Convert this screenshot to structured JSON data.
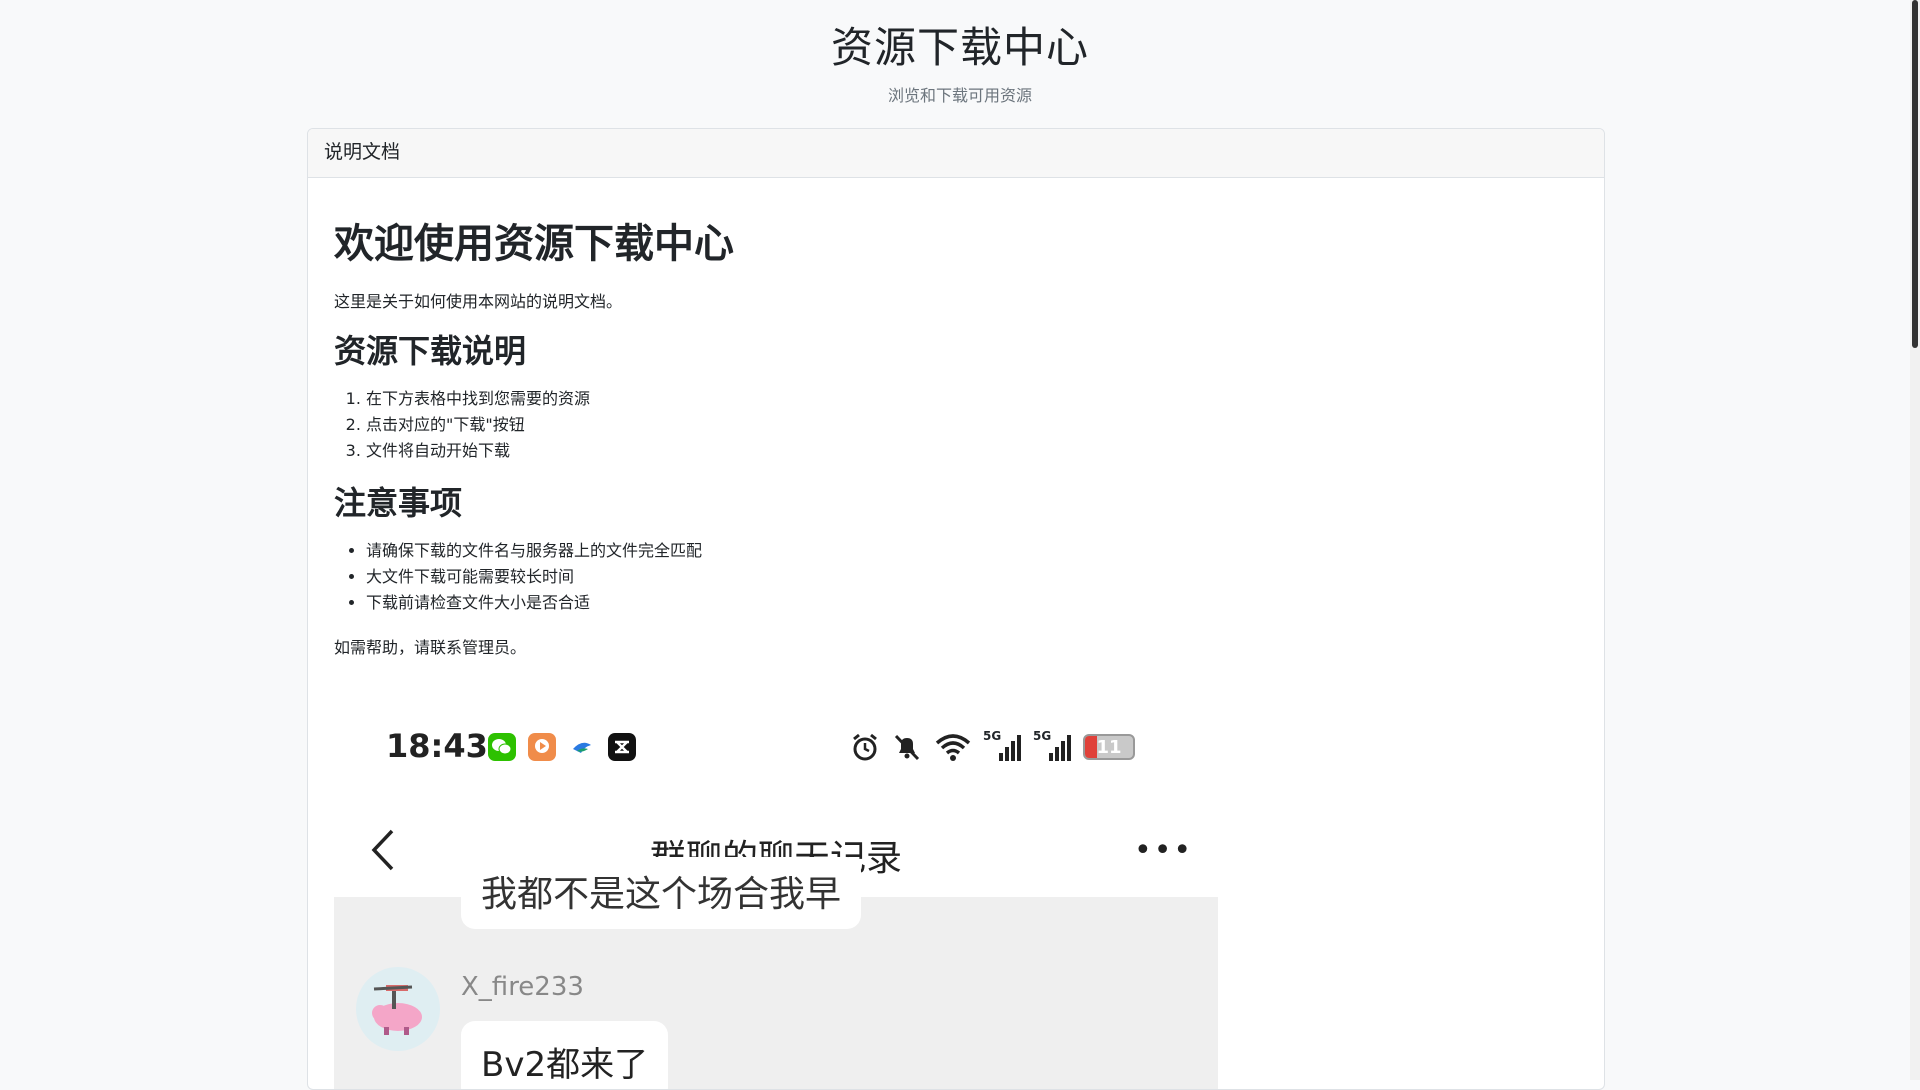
{
  "header": {
    "title": "资源下载中心",
    "subtitle": "浏览和下载可用资源"
  },
  "card": {
    "header_label": "说明文档"
  },
  "doc": {
    "h1": "欢迎使用资源下载中心",
    "intro": "这里是关于如何使用本网站的说明文档。",
    "section1_title": "资源下载说明",
    "steps": [
      "在下方表格中找到您需要的资源",
      "点击对应的\"下载\"按钮",
      "文件将自动开始下载"
    ],
    "section2_title": "注意事项",
    "notes": [
      "请确保下载的文件名与服务器上的文件完全匹配",
      "大文件下载可能需要较长时间",
      "下载前请检查文件大小是否合适"
    ],
    "help": "如需帮助，请联系管理员。"
  },
  "embedded_screenshot": {
    "time": "18:43",
    "battery": "11",
    "nav_title": "群聊的聊天记录",
    "more": "•••",
    "prev_message_partial": "我都不是这个场合我早",
    "sender": "X_fire233",
    "message": "Bv2都来了",
    "network_label": "5G"
  },
  "colors": {
    "wechat": "#2dc100",
    "battery_low": "#e0413a",
    "chat_bg": "#efefef"
  }
}
